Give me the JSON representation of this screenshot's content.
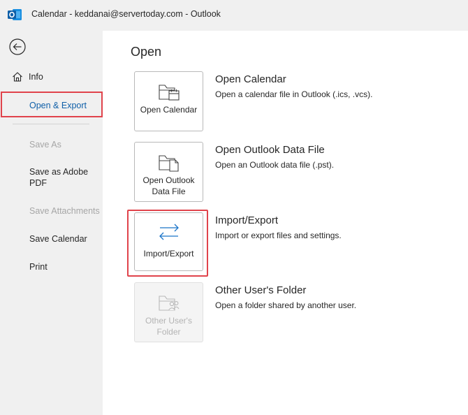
{
  "titlebar": {
    "title": "Calendar - keddanai@servertoday.com  -  Outlook",
    "app_icon": "outlook-logo-icon"
  },
  "sidebar": {
    "back_icon": "back-arrow-icon",
    "info_label": "Info",
    "info_icon": "home-icon",
    "open_export_label": "Open & Export",
    "save_as_label": "Save As",
    "save_adobe_pdf_label": "Save as Adobe PDF",
    "save_attachments_label": "Save Attachments",
    "save_calendar_label": "Save Calendar",
    "print_label": "Print"
  },
  "main": {
    "heading": "Open",
    "options": [
      {
        "tile_label": "Open Calendar",
        "title": "Open Calendar",
        "description": "Open a calendar file in Outlook (.ics, .vcs).",
        "icon": "calendar-folder-icon"
      },
      {
        "tile_label": "Open Outlook Data File",
        "title": "Open Outlook Data File",
        "description": "Open an Outlook data file (.pst).",
        "icon": "data-file-folder-icon"
      },
      {
        "tile_label": "Import/Export",
        "title": "Import/Export",
        "description": "Import or export files and settings.",
        "icon": "import-export-arrows-icon"
      },
      {
        "tile_label": "Other User's Folder",
        "title": "Other User's Folder",
        "description": "Open a folder shared by another user.",
        "icon": "shared-folder-icon"
      }
    ]
  },
  "colors": {
    "accent_blue": "#0f5fa8",
    "highlight_red": "#e0434b",
    "sidebar_bg": "#f0f0f0",
    "disabled_text": "#a6a6a6"
  }
}
